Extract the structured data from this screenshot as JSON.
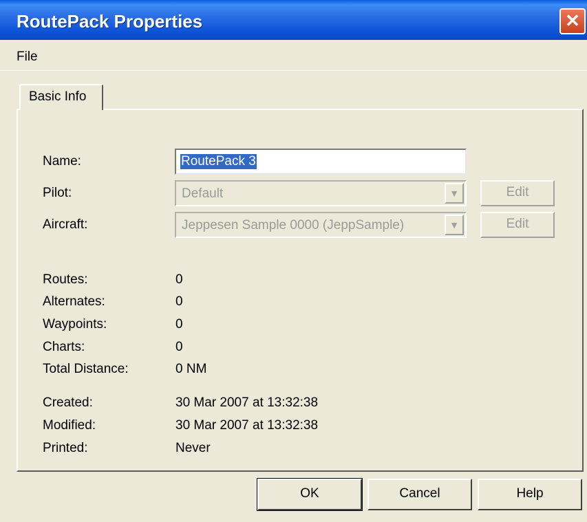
{
  "window": {
    "title": "RoutePack Properties",
    "close_symbol": "✕"
  },
  "menu": {
    "file": "File"
  },
  "tabs": [
    {
      "label": "Basic Info"
    }
  ],
  "form": {
    "name": {
      "label": "Name:",
      "value": "RoutePack 3"
    },
    "pilot": {
      "label": "Pilot:",
      "value": "Default",
      "edit_label": "Edit"
    },
    "aircraft": {
      "label": "Aircraft:",
      "value": "Jeppesen Sample 0000 (JeppSample)",
      "edit_label": "Edit"
    }
  },
  "stats": {
    "routes": {
      "label": "Routes:",
      "value": "0"
    },
    "alternates": {
      "label": "Alternates:",
      "value": "0"
    },
    "waypoints": {
      "label": "Waypoints:",
      "value": "0"
    },
    "charts": {
      "label": "Charts:",
      "value": "0"
    },
    "total_distance": {
      "label": "Total Distance:",
      "value": "0 NM"
    }
  },
  "dates": {
    "created": {
      "label": "Created:",
      "value": "30 Mar 2007 at 13:32:38"
    },
    "modified": {
      "label": "Modified:",
      "value": "30 Mar 2007 at 13:32:38"
    },
    "printed": {
      "label": "Printed:",
      "value": "Never"
    }
  },
  "buttons": {
    "ok": "OK",
    "cancel": "Cancel",
    "help": "Help"
  },
  "icons": {
    "dropdown_arrow": "▼"
  }
}
